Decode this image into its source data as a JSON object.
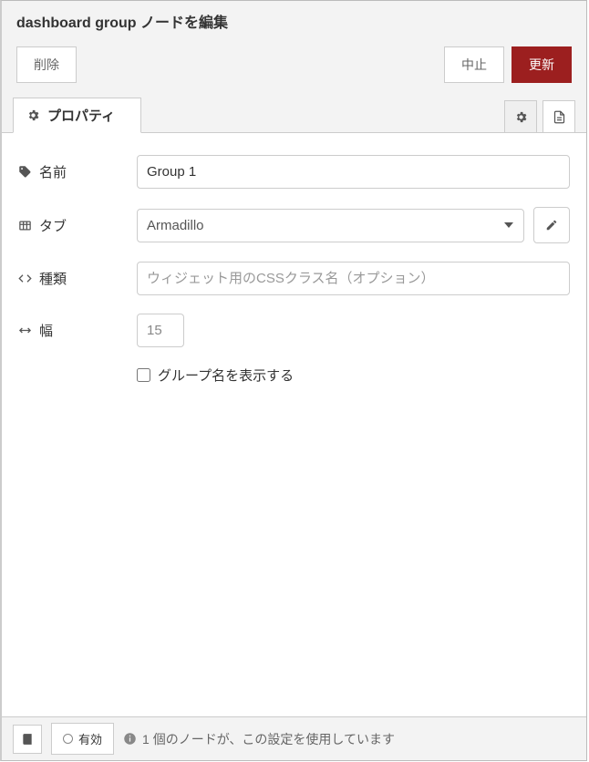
{
  "header": {
    "title": "dashboard group ノードを編集"
  },
  "actions": {
    "delete": "削除",
    "cancel": "中止",
    "update": "更新"
  },
  "tabs": {
    "properties": "プロパティ"
  },
  "form": {
    "name": {
      "label": "名前",
      "value": "Group 1"
    },
    "tab": {
      "label": "タブ",
      "value": "Armadillo"
    },
    "type": {
      "label": "種類",
      "placeholder": "ウィジェット用のCSSクラス名（オプション）"
    },
    "width": {
      "label": "幅",
      "value": "15"
    },
    "showGroupName": {
      "label": "グループ名を表示する"
    }
  },
  "footer": {
    "enabled": "有効",
    "usage": "1 個のノードが、この設定を使用しています"
  }
}
